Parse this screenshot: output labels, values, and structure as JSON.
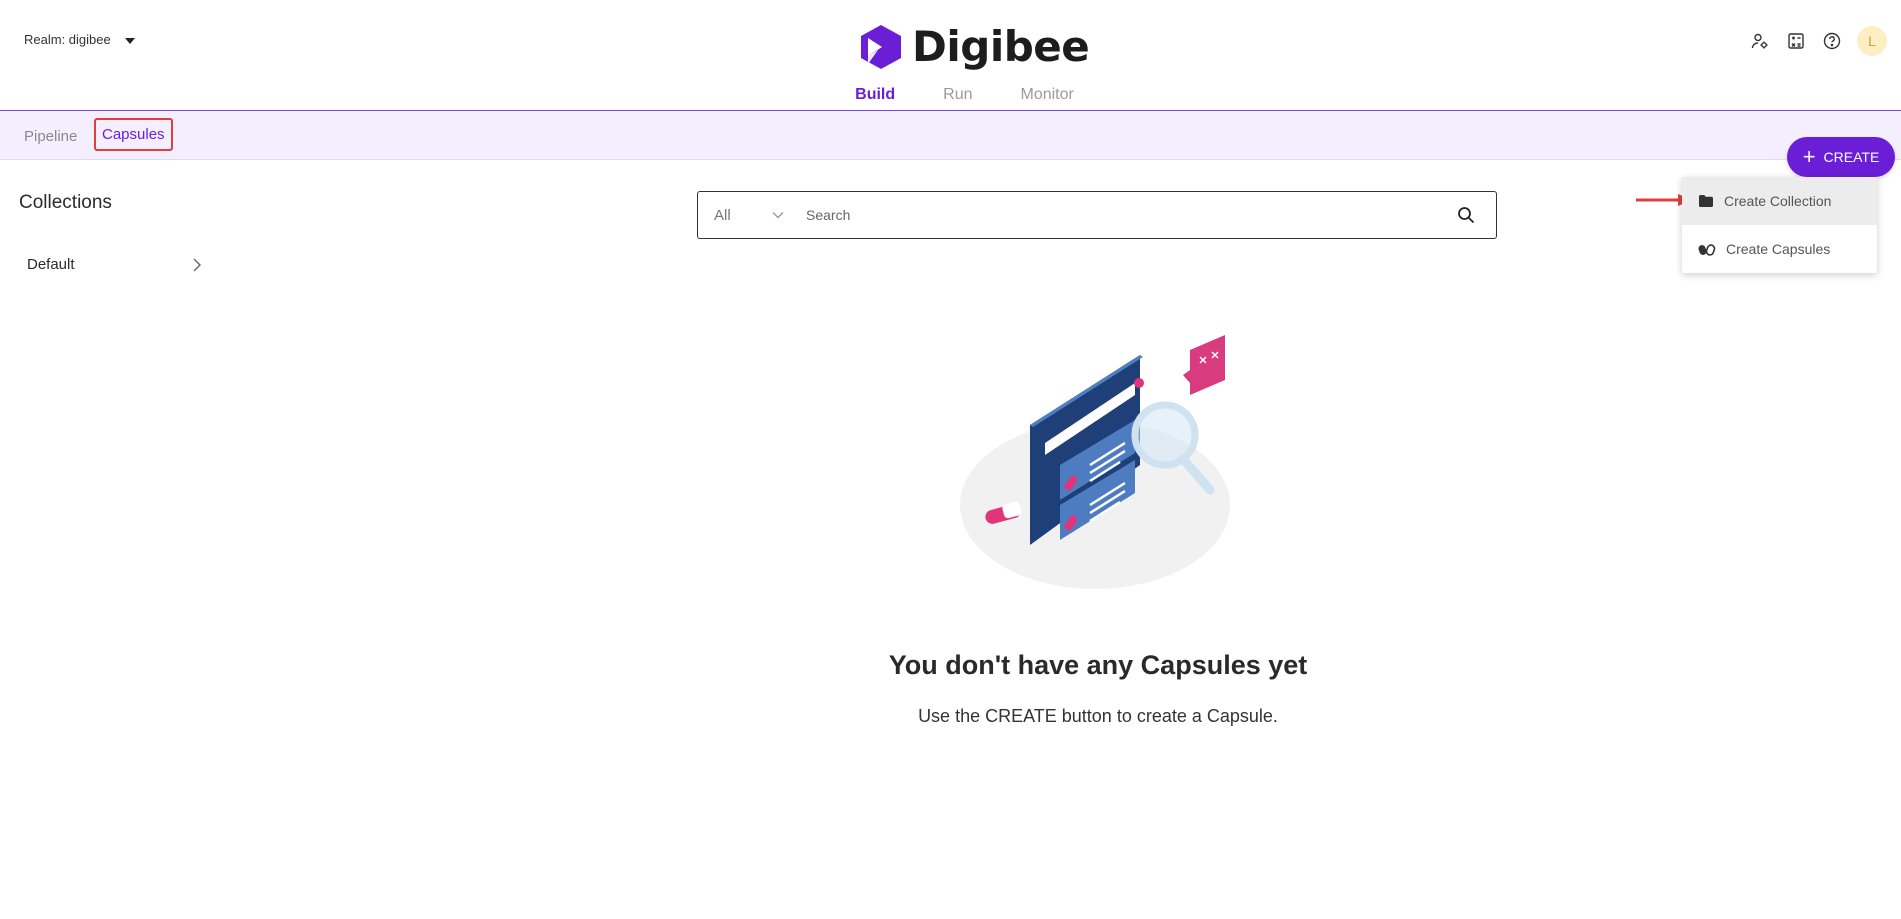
{
  "header": {
    "realm_label": "Realm: digibee",
    "brand": "Digibee",
    "user_initial": "L",
    "nav_tabs": [
      {
        "label": "Build",
        "active": true
      },
      {
        "label": "Run",
        "active": false
      },
      {
        "label": "Monitor",
        "active": false
      }
    ],
    "icons": [
      "user-settings-icon",
      "calculator-icon",
      "help-icon"
    ]
  },
  "subnav": {
    "pipeline_label": "Pipeline",
    "capsules_label": "Capsules"
  },
  "create_button": {
    "label": "CREATE"
  },
  "create_menu": {
    "items": [
      {
        "label": "Create Collection",
        "icon": "folder-icon"
      },
      {
        "label": "Create Capsules",
        "icon": "capsules-icon"
      }
    ]
  },
  "sidebar": {
    "title": "Collections",
    "items": [
      {
        "label": "Default"
      }
    ]
  },
  "search": {
    "filter_value": "All",
    "placeholder": "Search"
  },
  "empty_state": {
    "title": "You don't have any Capsules yet",
    "subtitle": "Use the CREATE button to create a Capsule."
  },
  "colors": {
    "accent": "#6a1ed6",
    "highlight_border": "#e33d3d",
    "subnav_bg": "#f4efff"
  }
}
